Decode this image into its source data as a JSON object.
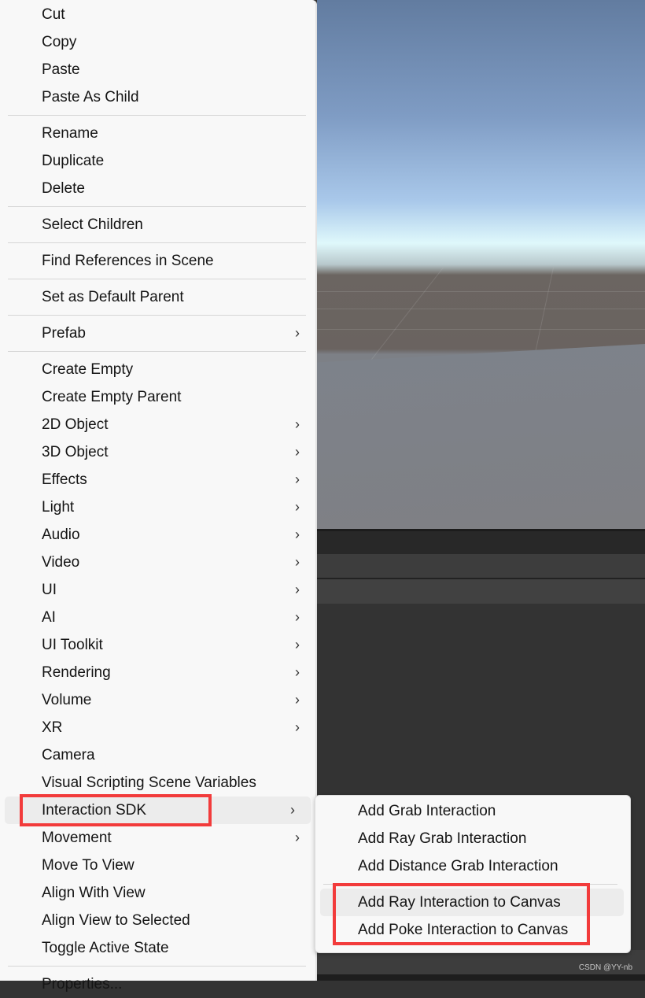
{
  "context_menu": {
    "groups": [
      [
        {
          "label": "Cut"
        },
        {
          "label": "Copy"
        },
        {
          "label": "Paste"
        },
        {
          "label": "Paste As Child"
        }
      ],
      [
        {
          "label": "Rename"
        },
        {
          "label": "Duplicate"
        },
        {
          "label": "Delete"
        }
      ],
      [
        {
          "label": "Select Children"
        }
      ],
      [
        {
          "label": "Find References in Scene"
        }
      ],
      [
        {
          "label": "Set as Default Parent"
        }
      ],
      [
        {
          "label": "Prefab",
          "submenu": true
        }
      ],
      [
        {
          "label": "Create Empty"
        },
        {
          "label": "Create Empty Parent"
        },
        {
          "label": "2D Object",
          "submenu": true
        },
        {
          "label": "3D Object",
          "submenu": true
        },
        {
          "label": "Effects",
          "submenu": true
        },
        {
          "label": "Light",
          "submenu": true
        },
        {
          "label": "Audio",
          "submenu": true
        },
        {
          "label": "Video",
          "submenu": true
        },
        {
          "label": "UI",
          "submenu": true
        },
        {
          "label": "AI",
          "submenu": true
        },
        {
          "label": "UI Toolkit",
          "submenu": true
        },
        {
          "label": "Rendering",
          "submenu": true
        },
        {
          "label": "Volume",
          "submenu": true
        },
        {
          "label": "XR",
          "submenu": true
        },
        {
          "label": "Camera"
        },
        {
          "label": "Visual Scripting Scene Variables"
        },
        {
          "label": "Interaction SDK",
          "submenu": true,
          "hovered": true,
          "highlighted": true
        },
        {
          "label": "Movement",
          "submenu": true
        },
        {
          "label": "Move To View"
        },
        {
          "label": "Align With View"
        },
        {
          "label": "Align View to Selected"
        },
        {
          "label": "Toggle Active State"
        }
      ],
      [
        {
          "label": "Properties..."
        }
      ]
    ]
  },
  "submenu": {
    "parent": "Interaction SDK",
    "groups": [
      [
        {
          "label": "Add Grab Interaction"
        },
        {
          "label": "Add Ray Grab Interaction"
        },
        {
          "label": "Add Distance Grab Interaction"
        }
      ],
      [
        {
          "label": "Add Ray Interaction to Canvas",
          "hovered": true,
          "highlighted": true
        },
        {
          "label": "Add Poke Interaction to Canvas",
          "highlighted": true
        }
      ]
    ]
  },
  "chevron_glyph": "›",
  "highlight_color": "#f23b3b",
  "watermark": "CSDN @YY-nb"
}
